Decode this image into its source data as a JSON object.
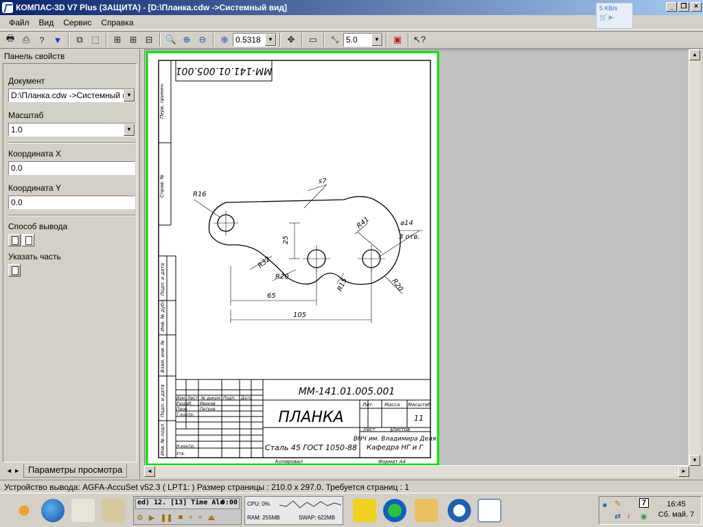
{
  "window": {
    "title": "КОМПАС-3D V7 Plus (ЗАЩИТА) - [D:\\Планка.cdw ->Системный вид]",
    "net_speed": "5 KB/s"
  },
  "menu": [
    "Файл",
    "Вид",
    "Сервис",
    "Справка"
  ],
  "toolbar": {
    "zoom_value": "0.5318",
    "step_value": "5.0"
  },
  "panel": {
    "title": "Панель свойств",
    "document_label": "Документ",
    "document_value": "D:\\Планка.cdw ->Системный ви",
    "scale_label": "Масштаб",
    "scale_value": "1.0",
    "coord_x_label": "Координата X",
    "coord_x_value": "0.0",
    "coord_y_label": "Координата Y",
    "coord_y_value": "0.0",
    "output_label": "Способ вывода",
    "part_label": "Указать часть",
    "tab_label": "Параметры просмотра"
  },
  "drawing": {
    "designation_mirror": "ММ-141.01.005.001",
    "designation": "ММ-141.01.005.001",
    "part_name": "ПЛАНКА",
    "material": "Сталь 45 ГОСТ 1050-88",
    "org_line1": "ВНЧ им. Владимира Деля",
    "org_line2": "Кафедра НГ и Г",
    "sheet_count": "11",
    "copied": "Копировал",
    "format": "Формат   А4",
    "col_lit": "Лит.",
    "col_mass": "Масса",
    "col_scale": "Масштаб",
    "col_sheet": "Лист",
    "col_sheets": "Листов",
    "stamp_cols": [
      "Изм",
      "Лист",
      "№ докум.",
      "Подп.",
      "Дата"
    ],
    "stamp_rows": [
      {
        "role": "Разраб.",
        "name": "Иванов"
      },
      {
        "role": "Пров.",
        "name": "Петров"
      },
      {
        "role": "Т.контр.",
        "name": ""
      },
      {
        "role": "Н.контр.",
        "name": ""
      },
      {
        "role": "Утв.",
        "name": ""
      }
    ],
    "side_labels": [
      "Подп. и дата",
      "Инв. № дубл.",
      "Взам. инв. №",
      "Подп. и дата",
      "Инв. № подл."
    ],
    "side_labels_top": [
      "Перв. примен.",
      "Справ. №"
    ],
    "dims": {
      "r16": "R16",
      "s7": "s7",
      "r41": "R41",
      "d14": "⌀14",
      "holes": "3 отв.",
      "d25": "25",
      "r32": "R32",
      "r20a": "R20",
      "r15": "R15",
      "r20b": "R20",
      "d65": "65",
      "d105": "105"
    }
  },
  "status": {
    "text": "Устройство вывода: AGFA-AccuSet v52.3 ( LPT1: )  Размер страницы : 210.0 x 297.0.  Требуется страниц : 1"
  },
  "taskbar": {
    "player_text": "ed)  12. [13] Time Alo",
    "player_time": "0:00",
    "cpu_label": "CPU: 0%",
    "ram_label": "RAM: 255MB",
    "swap_label": "SWAP: 622MB",
    "tray_badge": "7",
    "clock_time": "16:45",
    "clock_date": "Сб. май. 7"
  }
}
